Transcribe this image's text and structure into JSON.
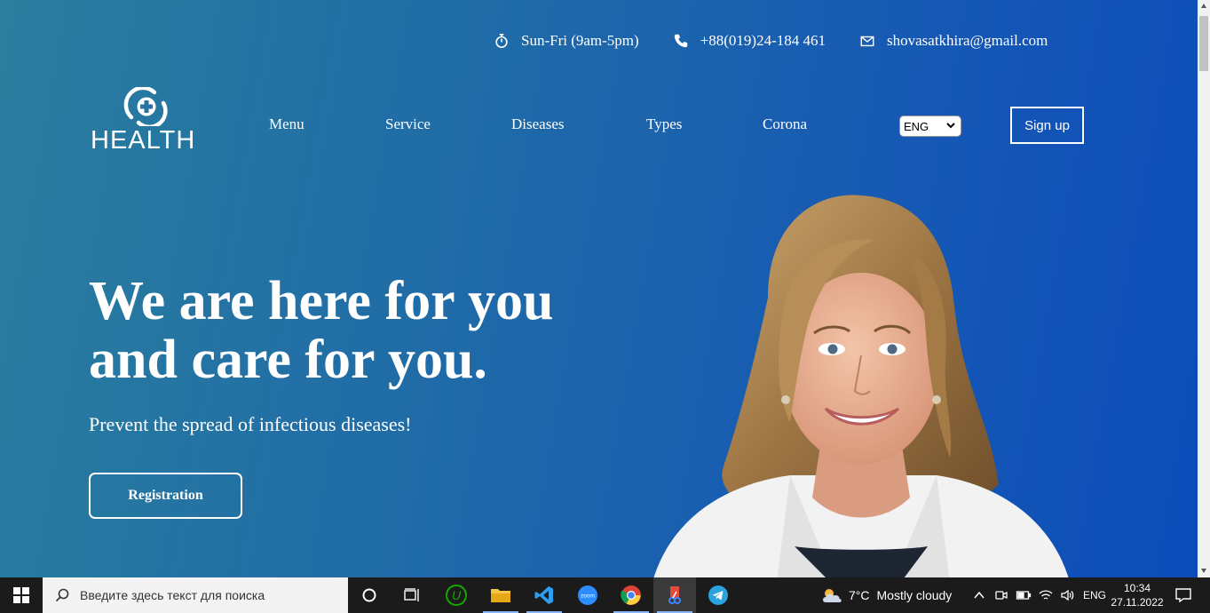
{
  "topbar": {
    "hours": "Sun-Fri (9am-5pm)",
    "phone": "+88(019)24-184 461",
    "email": "shovasatkhira@gmail.com"
  },
  "logo": {
    "word": "HEALTH"
  },
  "nav": {
    "items": [
      "Menu",
      "Service",
      "Diseases",
      "Types",
      "Corona"
    ]
  },
  "language": {
    "selected": "ENG"
  },
  "signup_label": "Sign up",
  "hero": {
    "title_line1": "We are here for you",
    "title_line2": "and care for you.",
    "subtitle": "Prevent the spread of infectious diseases!",
    "button": "Registration"
  },
  "taskbar": {
    "search_placeholder": "Введите здесь текст для поиска",
    "weather_temp": "7°C",
    "weather_desc": "Mostly cloudy",
    "lang": "ENG",
    "time": "10:34",
    "date": "27.11.2022"
  },
  "colors": {
    "gradient_start": "#2a7e9e",
    "gradient_end": "#0c4cba",
    "taskbar": "#1b1b1b"
  }
}
